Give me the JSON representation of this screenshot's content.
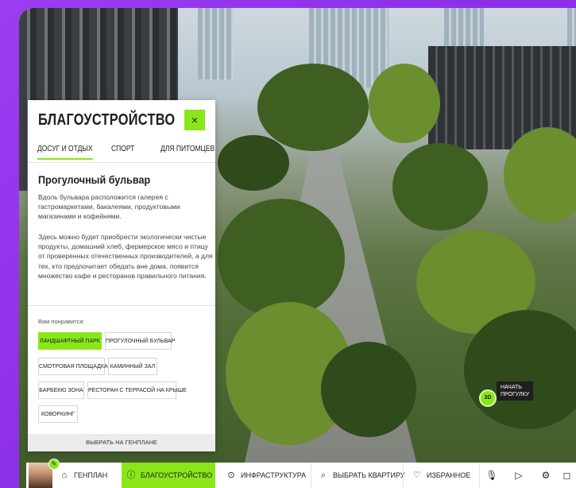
{
  "panel": {
    "title": "БЛАГОУСТРОЙСТВО",
    "close_icon": "×",
    "tabs": [
      {
        "label": "ДОСУГ И ОТДЫХ",
        "active": true
      },
      {
        "label": "СПОРТ",
        "active": false
      },
      {
        "label": "ДЛЯ ПИТОМЦЕВ",
        "active": false
      }
    ],
    "section_title": "Прогулочный бульвар",
    "paragraphs": [
      "Вдоль бульвара расположится галерея с гастромаркетами, бакалеями, продуктовыми магазинами и кофейнями.",
      "Здесь можно будет приобрести экологически чистые продукты, домашний хлеб, фермерское мясо и птицу от проверенных отечественных производителей, а для тех, кто предпочитает обедать вне дома, появится множество кафе и ресторанов правильного питания."
    ],
    "likes_label": "Вам понравится:",
    "chips": [
      {
        "label": "ЛАНДШАФТНЫЙ ПАРК",
        "active": true
      },
      {
        "label": "ПРОГУЛОЧНЫЙ БУЛЬВАР",
        "active": false
      },
      {
        "label": "СМОТРОВАЯ ПЛОЩАДКА",
        "active": false
      },
      {
        "label": "КАМИННЫЙ ЗАЛ",
        "active": false
      },
      {
        "label": "БАРБЕКЮ ЗОНА",
        "active": false
      },
      {
        "label": "РЕСТОРАН С ТЕРРАСОЙ НА КРЫШЕ",
        "active": false
      },
      {
        "label": "КОВОРКИНГ",
        "active": false
      }
    ],
    "footer_button": "ВЫБРАТЬ НА ГЕНПЛАНЕ"
  },
  "walk": {
    "icon_text": "3D",
    "label": "НАЧАТЬ\nПРОГУЛКУ"
  },
  "nav": {
    "items": [
      {
        "label": "ГЕНПЛАН",
        "icon": "building-icon",
        "active": false
      },
      {
        "label": "БЛАГОУСТРОЙСТВО",
        "icon": "info-icon",
        "active": true
      },
      {
        "label": "ИНФРАСТРУКТУРА",
        "icon": "pin-icon",
        "active": false
      },
      {
        "label": "ВЫБРАТЬ КВАРТИРУ",
        "icon": "search-icon",
        "active": false
      },
      {
        "label": "ИЗБРАННОЕ",
        "icon": "favorites-icon",
        "active": false
      }
    ],
    "buttons": [
      "microphone-icon",
      "play-icon",
      "gear-icon",
      "camera-icon"
    ]
  },
  "colors": {
    "accent": "#8ae619",
    "frame": "#8a2be2"
  }
}
